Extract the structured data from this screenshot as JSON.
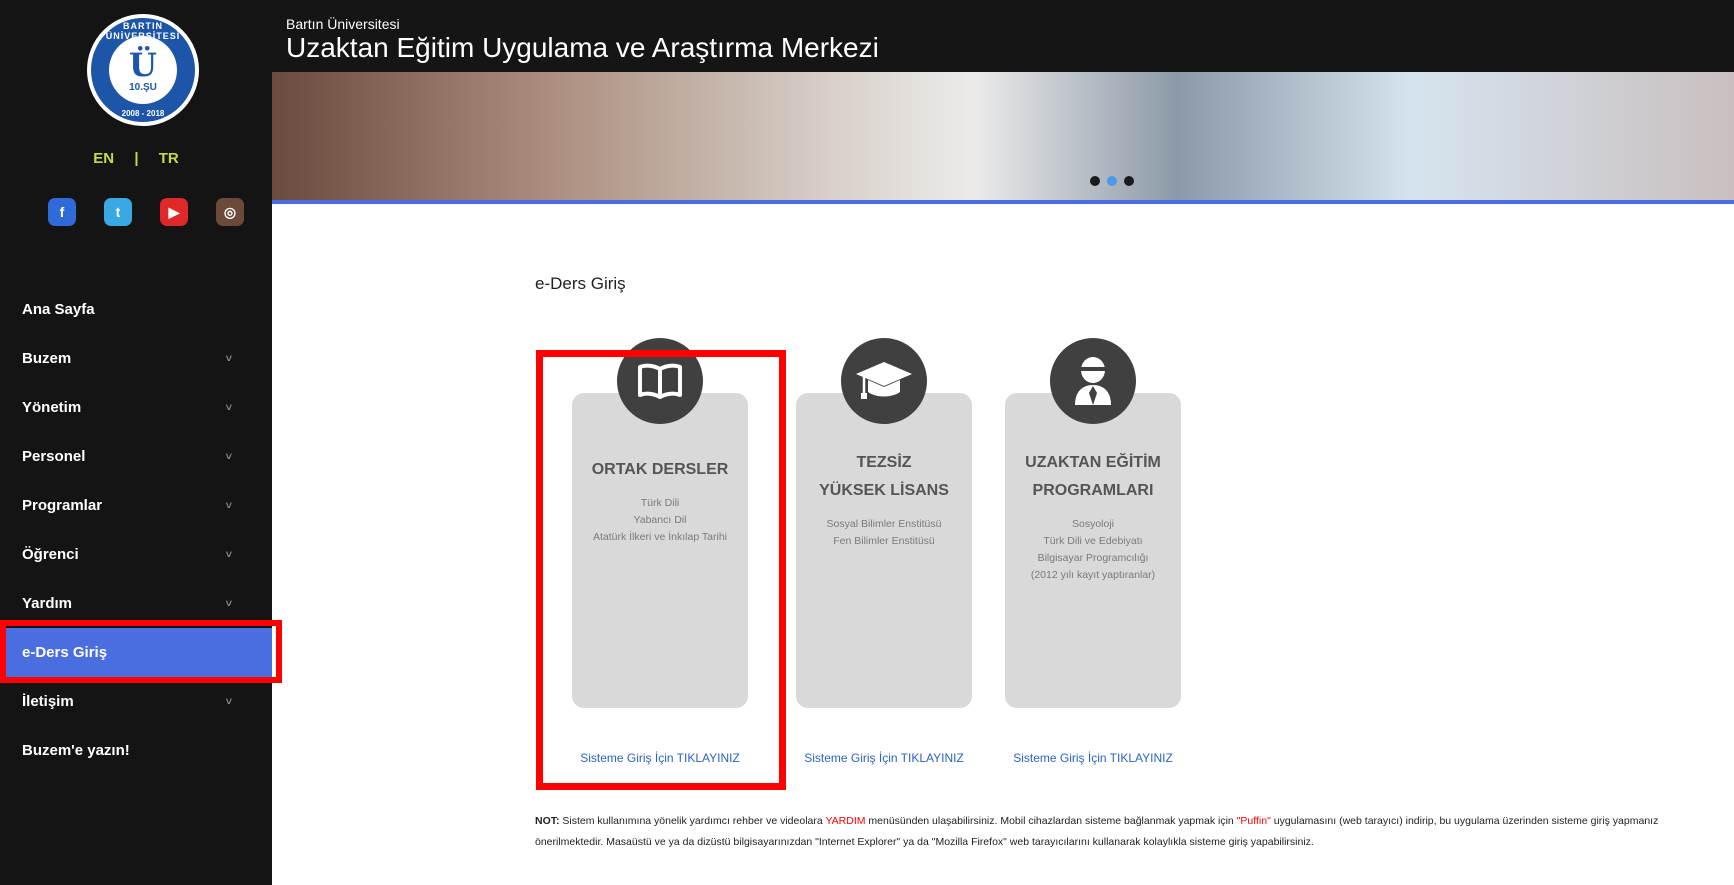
{
  "sidebar": {
    "logo": {
      "ring_top": "BARTIN ÜNİVERSİTESİ",
      "mark": "Ü",
      "subtitle": "10.ŞU",
      "ring_bottom": "2008 - 2018"
    },
    "lang": {
      "en": "EN",
      "sep": "|",
      "tr": "TR"
    },
    "social": [
      {
        "name": "facebook-icon",
        "glyph": "f",
        "color": "#2f6ad8"
      },
      {
        "name": "twitter-icon",
        "glyph": "t",
        "color": "#3aa8e2"
      },
      {
        "name": "youtube-icon",
        "glyph": "▶",
        "color": "#e02828"
      },
      {
        "name": "instagram-icon",
        "glyph": "◎",
        "color": "#6b4a3a"
      }
    ],
    "nav": [
      {
        "label": "Ana Sayfa",
        "chevron": false
      },
      {
        "label": "Buzem",
        "chevron": true
      },
      {
        "label": "Yönetim",
        "chevron": true
      },
      {
        "label": "Personel",
        "chevron": true
      },
      {
        "label": "Programlar",
        "chevron": true
      },
      {
        "label": "Öğrenci",
        "chevron": true
      },
      {
        "label": "Yardım",
        "chevron": true
      },
      {
        "label": "e-Ders Giriş",
        "chevron": false,
        "active": true
      },
      {
        "label": "İletişim",
        "chevron": true
      },
      {
        "label": "Buzem'e yazın!",
        "chevron": false
      }
    ],
    "chevron_glyph": "˅"
  },
  "header": {
    "university": "Bartın Üniversitesi",
    "center": "Uzaktan Eğitim Uygulama ve Araştırma Merkezi"
  },
  "banner": {
    "dots": 3,
    "active_dot": 1
  },
  "main": {
    "title": "e-Ders Giriş",
    "cards": [
      {
        "title_lines": [
          "ORTAK DERSLER"
        ],
        "sub_lines": [
          "Türk Dili",
          "Yabancı Dil",
          "Atatürk İlkeri ve İnkılap Tarihi"
        ],
        "link": "Sisteme Giriş İçin TIKLAYINIZ",
        "icon": "book-icon"
      },
      {
        "title_lines": [
          "TEZSİZ",
          "YÜKSEK LİSANS"
        ],
        "sub_lines": [
          "Sosyal Bilimler Enstitüsü",
          "Fen Bilimler Enstitüsü"
        ],
        "link": "Sisteme Giriş İçin TIKLAYINIZ",
        "icon": "graduation-cap-icon"
      },
      {
        "title_lines": [
          "UZAKTAN EĞİTİM",
          "PROGRAMLARI"
        ],
        "sub_lines": [
          "Sosyoloji",
          "Türk Dili ve Edebiyatı",
          "Bilgisayar Programcılığı",
          "(2012 yılı kayıt yaptıranlar)"
        ],
        "link": "Sisteme Giriş İçin TIKLAYINIZ",
        "icon": "user-graduate-icon"
      }
    ],
    "note": {
      "prefix": "NOT:",
      "part1": " Sistem kullanımına yönelik yardımcı rehber ve videolara ",
      "yardim": "YARDIM",
      "part2": " menüsünden ulaşabilirsiniz. Mobil cihazlardan sisteme bağlanmak yapmak için ",
      "puffin": "\"Puffin\"",
      "part3": " uygulamasını (web tarayıcı) indirip, bu uygulama üzerinden sisteme giriş yapmanız önerilmektedir. Masaüstü ve ya da dizüstü bilgisayarınızdan \"Internet Explorer\" ya da \"Mozilla Firefox\" web tarayıcılarını kullanarak kolaylıkla sisteme giriş yapabilirsiniz."
    }
  },
  "colors": {
    "sidebar_bg": "#141414",
    "active_nav": "#4a6ee0",
    "highlight": "#ff0000",
    "link": "#2a63c8"
  }
}
